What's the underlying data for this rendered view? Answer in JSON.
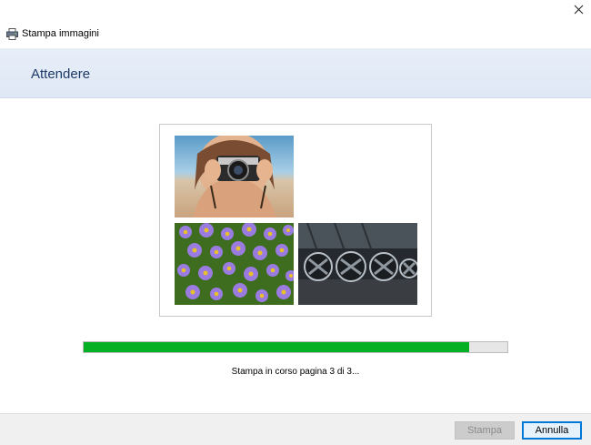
{
  "window": {
    "title": "Stampa immagini",
    "close_icon": "close-icon",
    "printer_icon": "printer-icon"
  },
  "header": {
    "heading": "Attendere"
  },
  "preview": {
    "photos": [
      {
        "name": "camera-photo",
        "subject": "woman-with-camera"
      },
      {
        "name": "flowers-photo",
        "subject": "purple-asters"
      },
      {
        "name": "machinery-photo",
        "subject": "industrial-turbines"
      }
    ]
  },
  "progress": {
    "value": 0.91,
    "color": "#06b025"
  },
  "status": {
    "text": "Stampa in corso pagina 3 di 3..."
  },
  "footer": {
    "print_label": "Stampa",
    "cancel_label": "Annulla"
  },
  "colors": {
    "header_text": "#1c3a68",
    "header_band": "#e3ebf6",
    "accent": "#0078d7"
  }
}
